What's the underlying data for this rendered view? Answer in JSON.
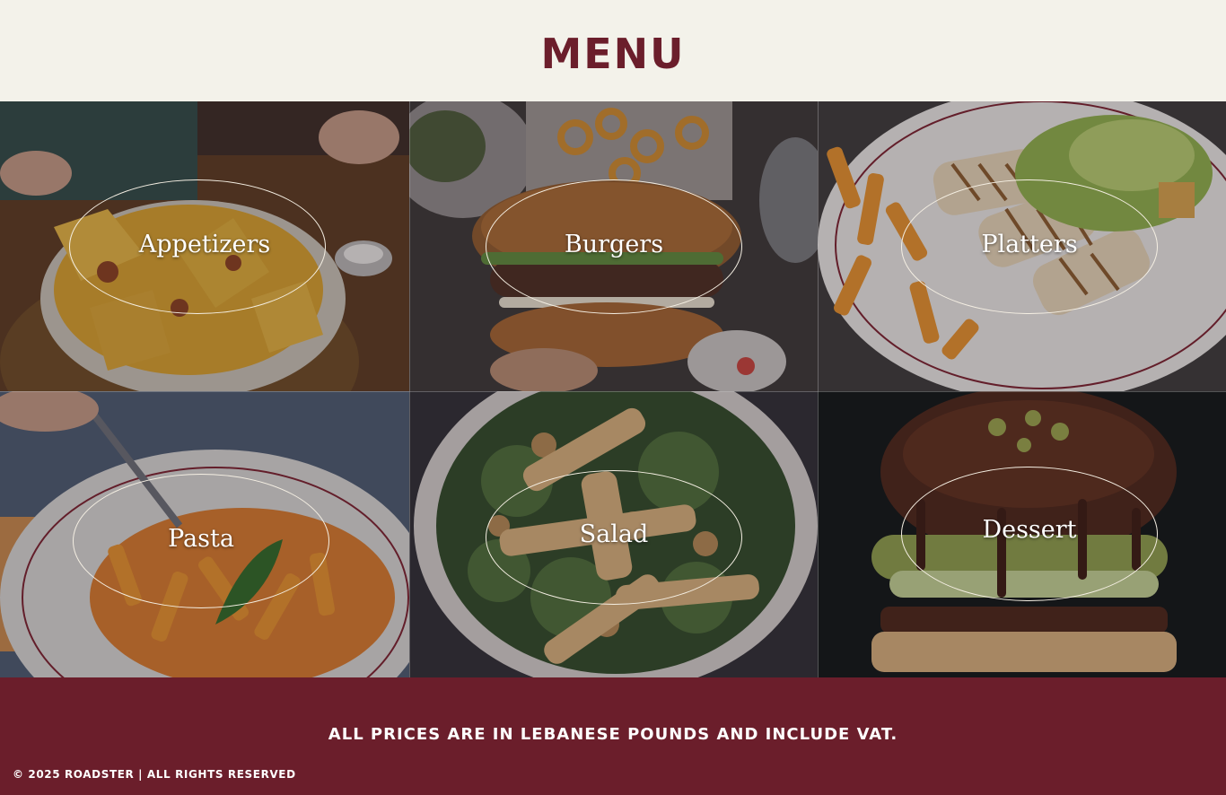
{
  "header": {
    "title": "MENU"
  },
  "menu": {
    "categories": [
      {
        "label": "Appetizers"
      },
      {
        "label": "Burgers"
      },
      {
        "label": "Platters"
      },
      {
        "label": "Pasta"
      },
      {
        "label": "Salad"
      },
      {
        "label": "Dessert"
      }
    ]
  },
  "footer": {
    "vat_note": "ALL PRICES ARE IN LEBANESE POUNDS AND INCLUDE VAT.",
    "copyright": "© 2025 ROADSTER | ALL RIGHTS RESERVED"
  },
  "colors": {
    "brand": "#6b1e2b",
    "background": "#f3f2ea",
    "label": "#ffffff"
  }
}
